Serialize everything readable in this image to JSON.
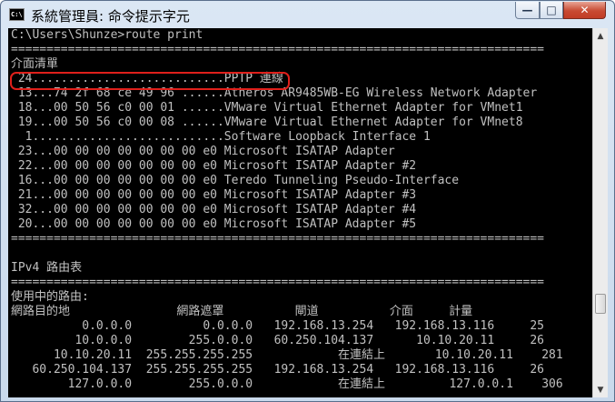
{
  "window": {
    "title": "系統管理員: 命令提示字元",
    "icon_text": "C:\\",
    "controls": {
      "minimize": "—",
      "maximize": "□",
      "close": "✕"
    }
  },
  "console": {
    "lines": [
      "C:\\Users\\Shunze>route print",
      "===========================================================================",
      "介面清單",
      " 24...........................PPTP 連線",
      " 13...74 2f 68 ce 49 96 ......Atheros AR9485WB-EG Wireless Network Adapter",
      " 18...00 50 56 c0 00 01 ......VMware Virtual Ethernet Adapter for VMnet1",
      " 19...00 50 56 c0 00 08 ......VMware Virtual Ethernet Adapter for VMnet8",
      "  1...........................Software Loopback Interface 1",
      " 23...00 00 00 00 00 00 00 e0 Microsoft ISATAP Adapter",
      " 22...00 00 00 00 00 00 00 e0 Microsoft ISATAP Adapter #2",
      " 16...00 00 00 00 00 00 00 e0 Teredo Tunneling Pseudo-Interface",
      " 21...00 00 00 00 00 00 00 e0 Microsoft ISATAP Adapter #3",
      " 32...00 00 00 00 00 00 00 e0 Microsoft ISATAP Adapter #4",
      " 20...00 00 00 00 00 00 00 e0 Microsoft ISATAP Adapter #5",
      "===========================================================================",
      "",
      "IPv4 路由表",
      "===========================================================================",
      "使用中的路由:",
      "網路目的地               網路遮罩          閘道          介面     計量",
      "          0.0.0.0          0.0.0.0   192.168.13.254   192.168.13.116     25",
      "         10.0.0.0        255.0.0.0   60.250.104.137      10.10.20.11     26",
      "      10.10.20.11  255.255.255.255            在連結上       10.10.20.11    281",
      "   60.250.104.137  255.255.255.255   192.168.13.254   192.168.13.116     26",
      "        127.0.0.0        255.0.0.0            在連結上         127.0.0.1    306"
    ]
  },
  "scrollbar": {
    "up": "▲",
    "down": "▼"
  }
}
